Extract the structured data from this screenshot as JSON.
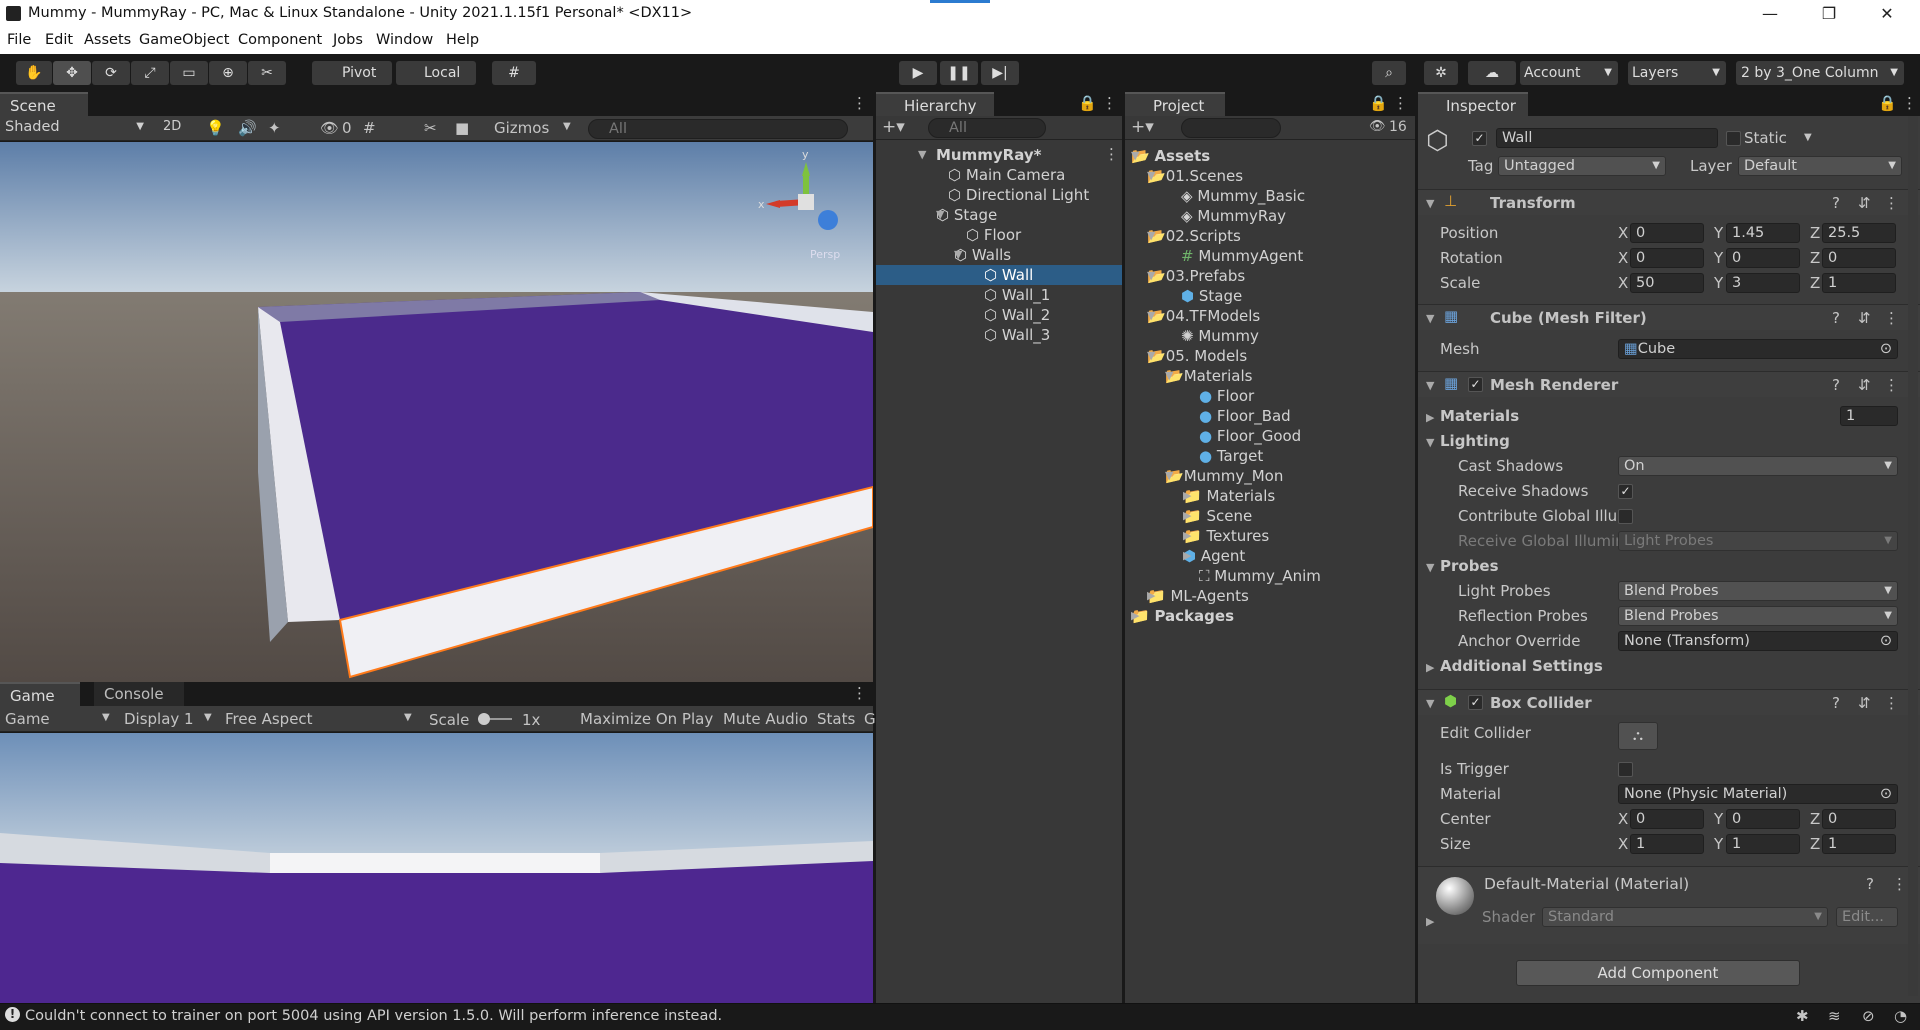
{
  "window": {
    "title": "Mummy - MummyRay - PC, Mac & Linux Standalone - Unity 2021.1.15f1 Personal* <DX11>",
    "minimize": "—",
    "maximize": "❐",
    "close": "✕"
  },
  "menu": [
    "File",
    "Edit",
    "Assets",
    "GameObject",
    "Component",
    "Jobs",
    "Window",
    "Help"
  ],
  "toolbar": {
    "pivot_label": "Pivot",
    "local_label": "Local",
    "account_label": "Account",
    "layers_label": "Layers",
    "layout_label": "2 by 3_One Column"
  },
  "scene": {
    "tab_label": "Scene",
    "shading_mode": "Shaded",
    "mode_2d": "2D",
    "hidden_count": "0",
    "gizmos_label": "Gizmos",
    "search_placeholder": "All",
    "gizmo_x": "x",
    "gizmo_y": "y",
    "persp_label": "Persp"
  },
  "game": {
    "tab_game": "Game",
    "tab_console": "Console",
    "mode": "Game",
    "display": "Display 1",
    "aspect": "Free Aspect",
    "scale_label": "Scale",
    "scale_value": "1x",
    "maximize_on_play": "Maximize On Play",
    "mute_audio": "Mute Audio",
    "stats": "Stats",
    "gizmos_cut": "G"
  },
  "hierarchy": {
    "tab_label": "Hierarchy",
    "search_placeholder": "All",
    "items": [
      {
        "label": "MummyRay*",
        "depth": 0,
        "expanded": true,
        "bold": true
      },
      {
        "label": "Main Camera",
        "depth": 1
      },
      {
        "label": "Directional Light",
        "depth": 1
      },
      {
        "label": "Stage",
        "depth": 1,
        "expanded": true
      },
      {
        "label": "Floor",
        "depth": 2
      },
      {
        "label": "Walls",
        "depth": 2,
        "expanded": true
      },
      {
        "label": "Wall",
        "depth": 3,
        "selected": true
      },
      {
        "label": "Wall_1",
        "depth": 3
      },
      {
        "label": "Wall_2",
        "depth": 3
      },
      {
        "label": "Wall_3",
        "depth": 3
      }
    ]
  },
  "project": {
    "tab_label": "Project",
    "hidden_count": "16",
    "items": [
      {
        "label": "Assets",
        "depth": 0,
        "type": "folder",
        "expanded": true,
        "bold": true
      },
      {
        "label": "01.Scenes",
        "depth": 1,
        "type": "folder",
        "expanded": true
      },
      {
        "label": "Mummy_Basic",
        "depth": 2,
        "type": "scene"
      },
      {
        "label": "MummyRay",
        "depth": 2,
        "type": "scene"
      },
      {
        "label": "02.Scripts",
        "depth": 1,
        "type": "folder",
        "expanded": true
      },
      {
        "label": "MummyAgent",
        "depth": 2,
        "type": "script"
      },
      {
        "label": "03.Prefabs",
        "depth": 1,
        "type": "folder",
        "expanded": true
      },
      {
        "label": "Stage",
        "depth": 2,
        "type": "prefab"
      },
      {
        "label": "04.TFModels",
        "depth": 1,
        "type": "folder",
        "expanded": true
      },
      {
        "label": "Mummy",
        "depth": 2,
        "type": "model"
      },
      {
        "label": "05. Models",
        "depth": 1,
        "type": "folder",
        "expanded": true
      },
      {
        "label": "Materials",
        "depth": 2,
        "type": "folder",
        "expanded": true
      },
      {
        "label": "Floor",
        "depth": 3,
        "type": "material"
      },
      {
        "label": "Floor_Bad",
        "depth": 3,
        "type": "material"
      },
      {
        "label": "Floor_Good",
        "depth": 3,
        "type": "material"
      },
      {
        "label": "Target",
        "depth": 3,
        "type": "material"
      },
      {
        "label": "Mummy_Mon",
        "depth": 2,
        "type": "folder",
        "expanded": true
      },
      {
        "label": "Materials",
        "depth": 3,
        "type": "folder",
        "collapsed": true
      },
      {
        "label": "Scene",
        "depth": 3,
        "type": "folder",
        "collapsed": true
      },
      {
        "label": "Textures",
        "depth": 3,
        "type": "folder",
        "collapsed": true
      },
      {
        "label": "Agent",
        "depth": 3,
        "type": "prefab",
        "collapsed": true
      },
      {
        "label": "Mummy_Anim",
        "depth": 3,
        "type": "anim"
      },
      {
        "label": "ML-Agents",
        "depth": 1,
        "type": "folder",
        "collapsed": true
      },
      {
        "label": "Packages",
        "depth": 0,
        "type": "folder",
        "collapsed": true,
        "bold": true
      }
    ]
  },
  "inspector": {
    "tab_label": "Inspector",
    "object_name": "Wall",
    "static_label": "Static",
    "tag_label": "Tag",
    "tag_value": "Untagged",
    "layer_label": "Layer",
    "layer_value": "Default",
    "transform": {
      "title": "Transform",
      "position_label": "Position",
      "position": [
        "0",
        "1.45",
        "25.5"
      ],
      "rotation_label": "Rotation",
      "rotation": [
        "0",
        "0",
        "0"
      ],
      "scale_label": "Scale",
      "scale": [
        "50",
        "3",
        "1"
      ],
      "x": "X",
      "y": "Y",
      "z": "Z"
    },
    "mesh_filter": {
      "title": "Cube (Mesh Filter)",
      "mesh_label": "Mesh",
      "mesh_value": "Cube"
    },
    "mesh_renderer": {
      "title": "Mesh Renderer",
      "materials_label": "Materials",
      "materials_count": "1",
      "lighting_label": "Lighting",
      "cast_shadows_label": "Cast Shadows",
      "cast_shadows_value": "On",
      "receive_shadows_label": "Receive Shadows",
      "contribute_gi_label": "Contribute Global Illun",
      "receive_gi_label": "Receive Global Illumir",
      "receive_gi_value": "Light Probes",
      "probes_label": "Probes",
      "light_probes_label": "Light Probes",
      "light_probes_value": "Blend Probes",
      "reflection_probes_label": "Reflection Probes",
      "reflection_probes_value": "Blend Probes",
      "anchor_override_label": "Anchor Override",
      "anchor_override_value": "None (Transform)",
      "additional_settings_label": "Additional Settings"
    },
    "box_collider": {
      "title": "Box Collider",
      "edit_collider_label": "Edit Collider",
      "is_trigger_label": "Is Trigger",
      "material_label": "Material",
      "material_value": "None (Physic Material)",
      "center_label": "Center",
      "center": [
        "0",
        "0",
        "0"
      ],
      "size_label": "Size",
      "size": [
        "1",
        "1",
        "1"
      ]
    },
    "material": {
      "title": "Default-Material (Material)",
      "shader_label": "Shader",
      "shader_value": "Standard",
      "edit_label": "Edit..."
    },
    "add_component_label": "Add Component"
  },
  "status_bar": {
    "message": "Couldn't connect to trainer on port 5004 using API version 1.5.0. Will perform inference instead."
  },
  "colors": {
    "selection": "#2c5d87",
    "floor_purple": "#4b2a8c",
    "editor_bg": "#383838",
    "dark_bg": "#191919"
  }
}
